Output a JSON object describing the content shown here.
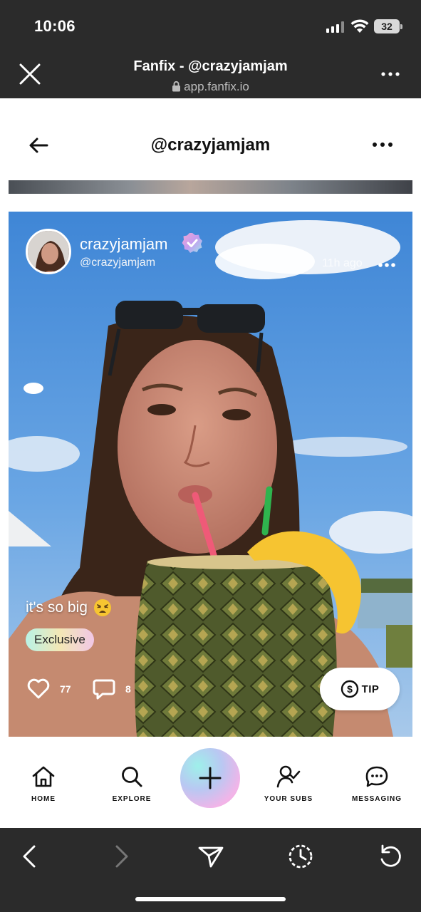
{
  "status_bar": {
    "time": "10:06",
    "battery": "32"
  },
  "browser": {
    "title": "Fanfix - @crazyjamjam",
    "url": "app.fanfix.io"
  },
  "header": {
    "title": "@crazyjamjam"
  },
  "post": {
    "creator_name": "crazyjamjam",
    "creator_handle": "@crazyjamjam",
    "time_ago": "11h ago",
    "caption": "it's so big",
    "badge": "Exclusive",
    "likes": "77",
    "comments": "8",
    "tip_label": "TIP"
  },
  "nav": {
    "items": [
      {
        "label": "HOME",
        "icon": "home-icon"
      },
      {
        "label": "EXPLORE",
        "icon": "search-icon"
      },
      {
        "label": "",
        "icon": "plus-icon"
      },
      {
        "label": "YOUR SUBS",
        "icon": "user-check-icon"
      },
      {
        "label": "MESSAGING",
        "icon": "message-icon"
      }
    ]
  },
  "colors": {
    "chrome": "#2b2b2b",
    "accent_gradient_start": "#9ef0ea",
    "accent_gradient_end": "#f4a6d8",
    "verified": "#c98ee8"
  }
}
